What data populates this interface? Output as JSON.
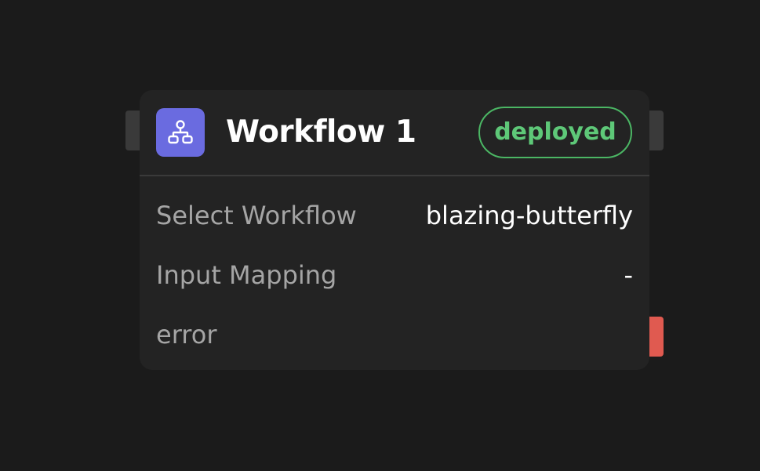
{
  "node": {
    "icon": "workflow-hierarchy-icon",
    "title": "Workflow 1",
    "status": "deployed",
    "fields": [
      {
        "label": "Select Workflow",
        "value": "blazing-butterfly"
      },
      {
        "label": "Input Mapping",
        "value": "-"
      }
    ],
    "error_label": "error"
  },
  "colors": {
    "canvas_bg": "#1b1b1b",
    "node_bg": "#232323",
    "icon_bg": "#6a6be0",
    "status_green": "#4bb664",
    "error_red": "#e05a50",
    "handle_gray": "#3a3a3a"
  }
}
